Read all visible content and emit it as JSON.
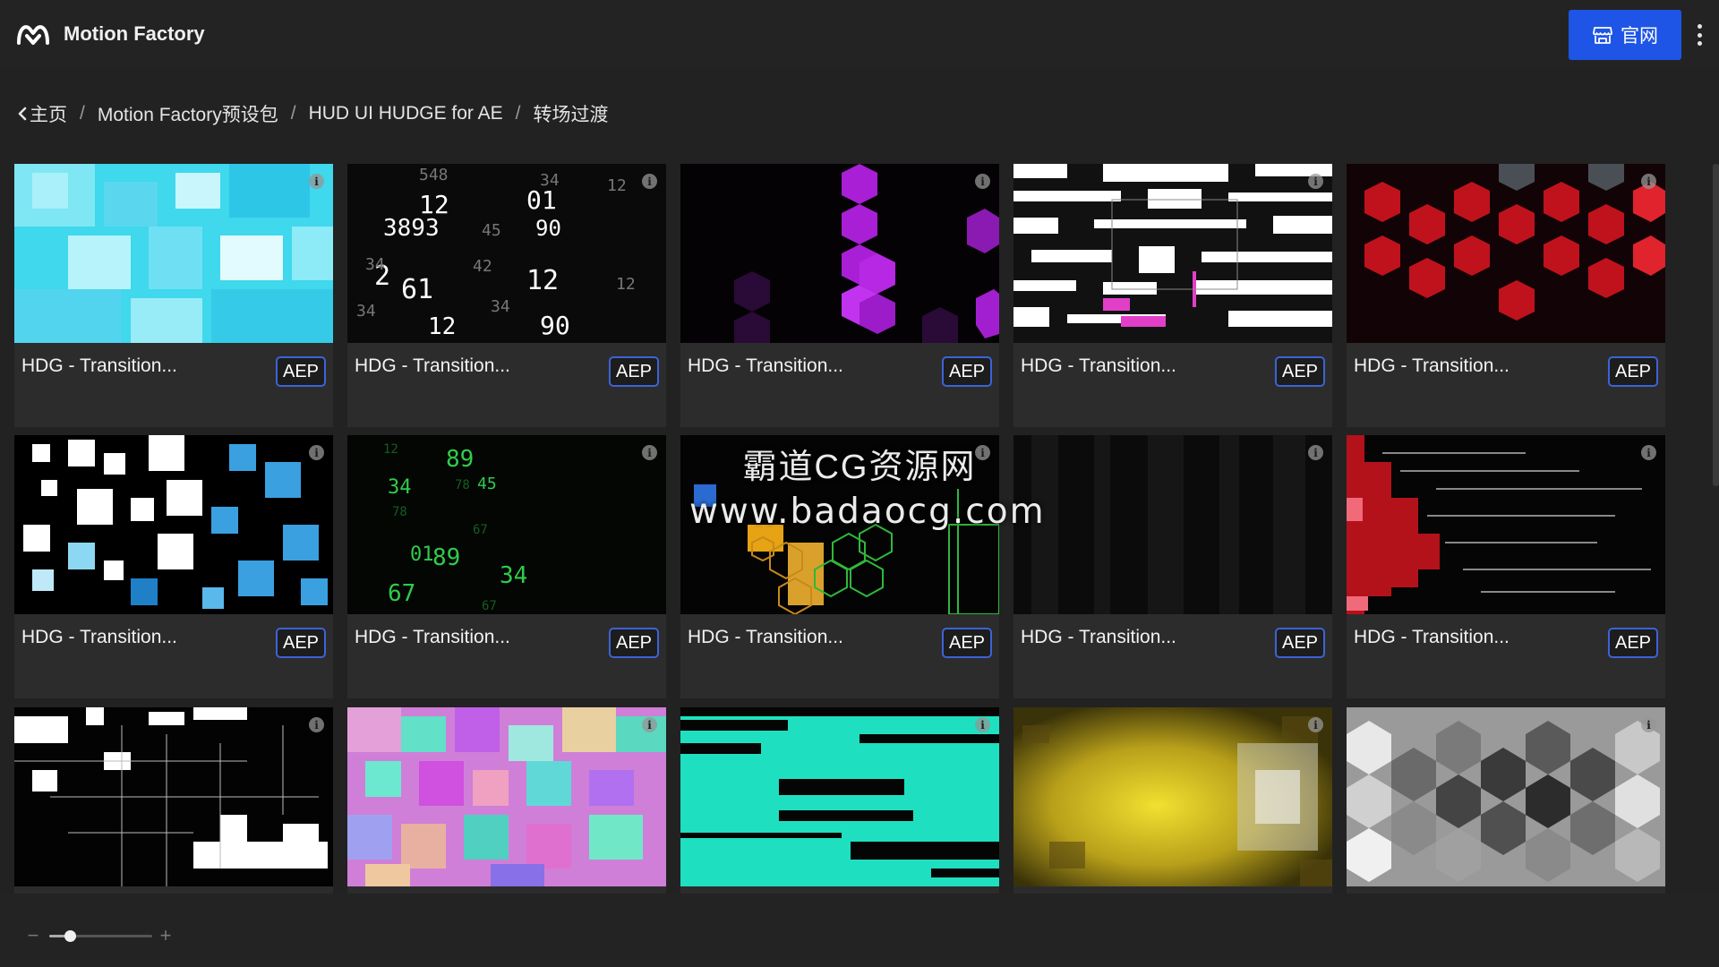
{
  "header": {
    "app_title": "Motion Factory",
    "site_button_label": "官网",
    "accent_color": "#1e55e6"
  },
  "breadcrumb": {
    "items": [
      {
        "label": "主页"
      },
      {
        "label": "Motion Factory预设包"
      },
      {
        "label": "HUD UI HUDGE for AE"
      },
      {
        "label": "转场过渡"
      }
    ],
    "separator": "/"
  },
  "grid": {
    "cards": [
      {
        "title": "HDG - Transition...",
        "badge": "AEP"
      },
      {
        "title": "HDG - Transition...",
        "badge": "AEP"
      },
      {
        "title": "HDG - Transition...",
        "badge": "AEP"
      },
      {
        "title": "HDG - Transition...",
        "badge": "AEP"
      },
      {
        "title": "HDG - Transition...",
        "badge": "AEP"
      },
      {
        "title": "HDG - Transition...",
        "badge": "AEP"
      },
      {
        "title": "HDG - Transition...",
        "badge": "AEP"
      },
      {
        "title": "HDG - Transition...",
        "badge": "AEP"
      },
      {
        "title": "HDG - Transition...",
        "badge": "AEP"
      },
      {
        "title": "HDG - Transition...",
        "badge": "AEP"
      },
      {
        "title": "",
        "badge": ""
      },
      {
        "title": "",
        "badge": ""
      },
      {
        "title": "",
        "badge": ""
      },
      {
        "title": "",
        "badge": ""
      },
      {
        "title": "",
        "badge": ""
      }
    ],
    "info_icon_glyph": "i"
  },
  "watermark": {
    "line1": "霸道CG资源网",
    "line2": "www.badaocg.com"
  },
  "zoom": {
    "minus_label": "−",
    "plus_label": "+",
    "level": 0.2
  }
}
